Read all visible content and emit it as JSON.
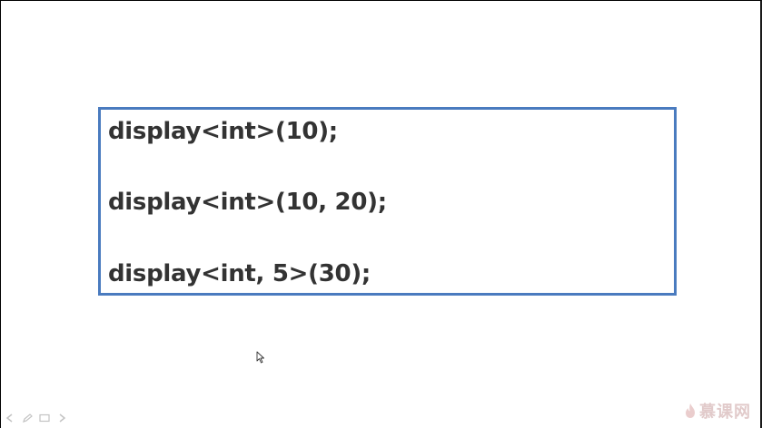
{
  "slide": {
    "code_lines": [
      "display<int>(10);",
      "display<int>(10, 20);",
      "display<int, 5>(30);"
    ]
  },
  "watermark": {
    "text": "慕课网"
  },
  "colors": {
    "box_border": "#4a7bbf",
    "code_text": "#333333",
    "watermark": "#c9a0a0"
  },
  "icons": {
    "cursor": "mouse-pointer-icon",
    "controls": [
      "previous-icon",
      "pen-icon",
      "slides-icon",
      "next-icon"
    ],
    "logo": "flame-logo-icon"
  }
}
